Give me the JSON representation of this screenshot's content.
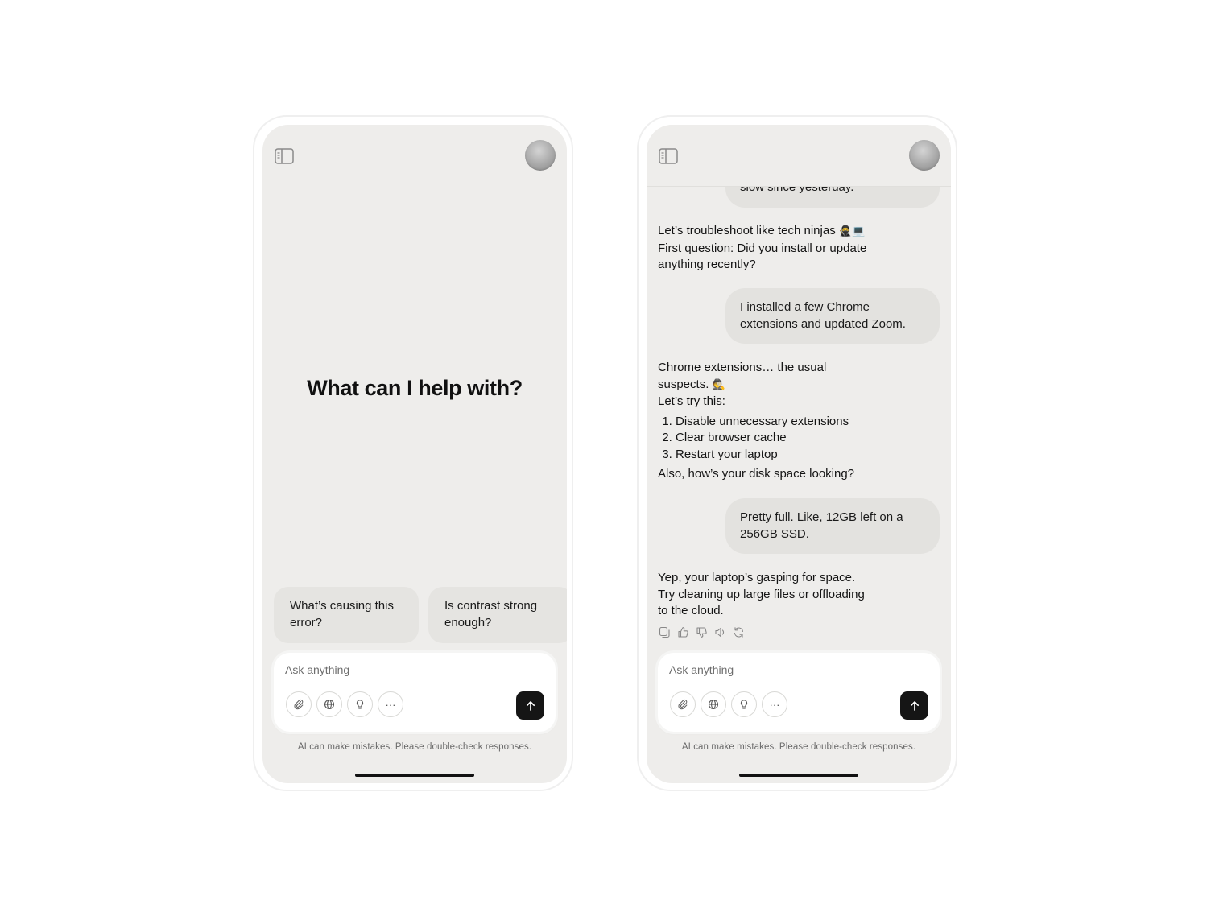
{
  "left_screen": {
    "heading": "What can I help with?",
    "suggestions": [
      "What’s causing this error?",
      "Is contrast strong enough?"
    ]
  },
  "right_screen": {
    "messages": [
      {
        "role": "user",
        "text": "slow since yesterday."
      },
      {
        "role": "assistant",
        "lines": [
          "Let’s troubleshoot like tech ninjas",
          "First question: Did you install or update anything recently?"
        ],
        "emoji": "🥷💻"
      },
      {
        "role": "user",
        "text": "I installed a few Chrome extensions and updated Zoom."
      },
      {
        "role": "assistant",
        "intro": "Chrome extensions… the usual suspects.",
        "emoji": "🕵️",
        "lead": "Let’s try this:",
        "steps": [
          "Disable unnecessary extensions",
          "Clear browser cache",
          "Restart your laptop"
        ],
        "outro": "Also, how’s your disk space looking?"
      },
      {
        "role": "user",
        "text": "Pretty full. Like, 12GB left on a 256GB SSD."
      },
      {
        "role": "assistant",
        "text": "Yep, your laptop’s gasping for space. Try cleaning up large files or offloading to the cloud."
      }
    ],
    "message_actions": [
      "copy-icon",
      "thumbs-up-icon",
      "thumbs-down-icon",
      "speaker-icon",
      "regenerate-icon"
    ]
  },
  "composer": {
    "placeholder": "Ask anything",
    "tools": [
      "paperclip-icon",
      "globe-icon",
      "lightbulb-icon",
      "more-icon"
    ],
    "more_label": "···",
    "send_icon": "arrow-up-icon"
  },
  "disclaimer": "AI can make mistakes. Please double-check responses.",
  "colors": {
    "screen_bg": "#eeedeb",
    "bubble_bg": "#e3e2df",
    "send_bg": "#151515",
    "composer_bg": "#ffffff"
  }
}
